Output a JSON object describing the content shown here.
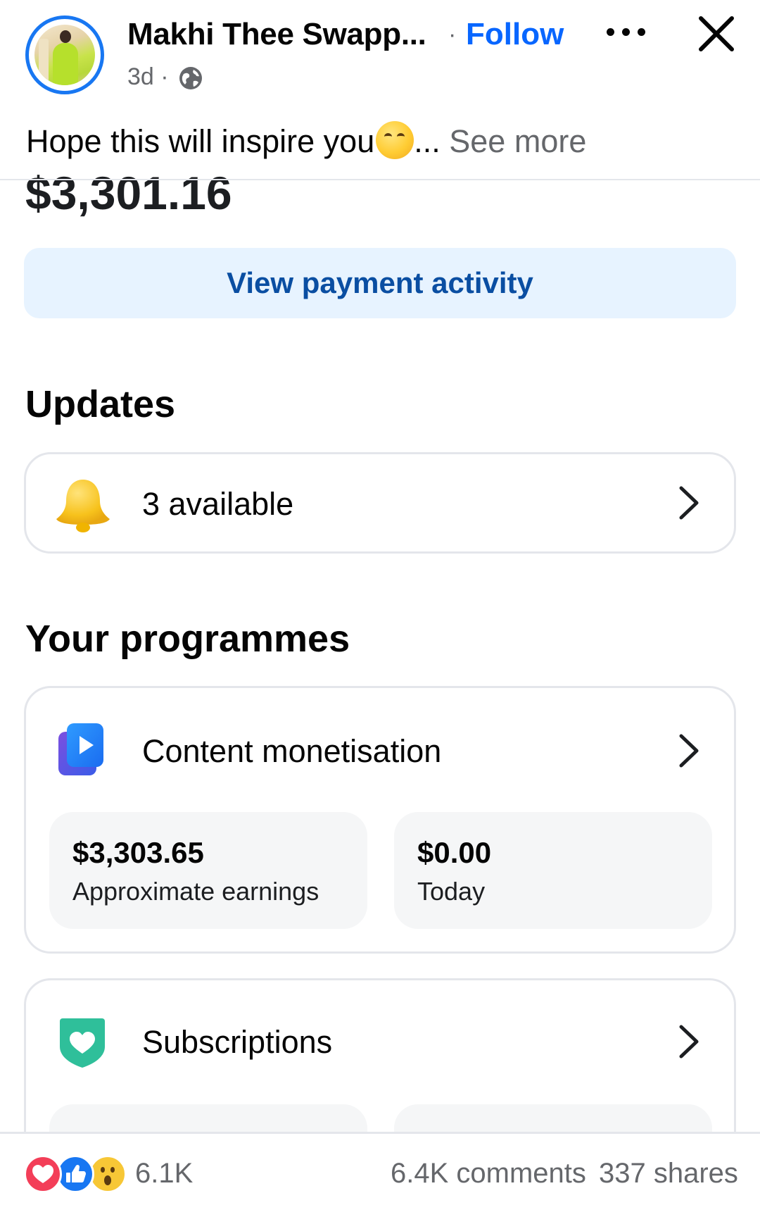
{
  "post": {
    "author": "Makhi Thee Swapp...",
    "separator": "·",
    "follow_label": "Follow",
    "time": "3d ·",
    "caption": "Hope this will inspire you",
    "caption_ellipsis": "...",
    "see_more": "See more"
  },
  "screenshot": {
    "balance": "$3,301.16",
    "payment_button": "View payment activity",
    "updates": {
      "title": "Updates",
      "item_label": "3 available"
    },
    "programmes": {
      "title": "Your programmes",
      "content_monetisation": {
        "label": "Content monetisation",
        "stats": [
          {
            "value": "$3,303.65",
            "label": "Approximate earnings"
          },
          {
            "value": "$0.00",
            "label": "Today"
          }
        ]
      },
      "subscriptions": {
        "label": "Subscriptions"
      }
    }
  },
  "footer": {
    "reaction_count": "6.1K",
    "comments": "6.4K comments",
    "shares": "337 shares"
  },
  "icons": [
    "love-reaction-icon",
    "like-reaction-icon",
    "wow-reaction-icon",
    "bell-icon",
    "play-icon",
    "heart-shield-icon",
    "chevron-right-icon",
    "globe-icon",
    "more-icon",
    "close-icon"
  ],
  "colors": {
    "accent": "#0866ff",
    "button_bg": "#e7f3ff",
    "button_text": "#0a4ea2"
  }
}
